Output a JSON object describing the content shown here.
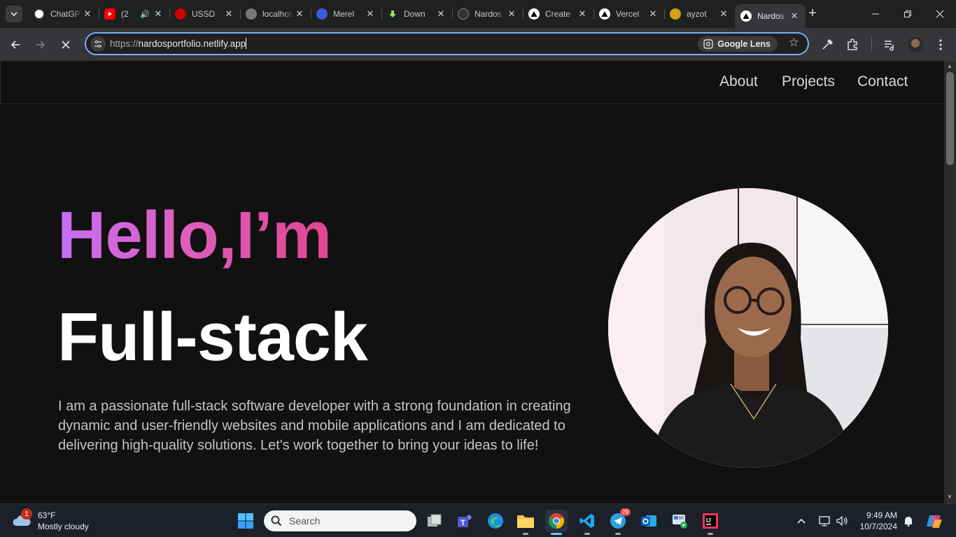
{
  "browser": {
    "tabs": [
      {
        "title": "ChatGPT",
        "favicon": "chatgpt-icon",
        "color": "#ffffff"
      },
      {
        "title": "(2",
        "favicon": "youtube-icon",
        "color": "#ff0000",
        "audio": true
      },
      {
        "title": "USSD",
        "favicon": "redhat-icon",
        "color": "#cc0000"
      },
      {
        "title": "localhost",
        "favicon": "globe-icon",
        "color": "#777777"
      },
      {
        "title": "Merel",
        "favicon": "merel-icon",
        "color": "#3b5bdb"
      },
      {
        "title": "Down",
        "favicon": "download-icon",
        "color": "#4caf50"
      },
      {
        "title": "Nardos",
        "favicon": "github-icon",
        "color": "#333333"
      },
      {
        "title": "Create",
        "favicon": "vercel-icon",
        "color": "#000000"
      },
      {
        "title": "Vercel",
        "favicon": "vercel-icon",
        "color": "#000000"
      },
      {
        "title": "ayzot",
        "favicon": "ayzot-icon",
        "color": "#d4a017"
      },
      {
        "title": "Nardos",
        "favicon": "vercel-icon",
        "color": "#000000",
        "active": true
      }
    ],
    "url_scheme": "https://",
    "url_host": "nardosportfolio.netlify.app",
    "lens_label": "Google Lens"
  },
  "site": {
    "nav": {
      "about": "About",
      "projects": "Projects",
      "contact": "Contact"
    },
    "hello": "Hello,I’m",
    "role": "Full-stack",
    "bio": "I am a passionate full-stack software developer with a strong foundation in creating dynamic and user-friendly websites and mobile applications and I am dedicated to delivering high-quality solutions. Let's work together to bring your ideas to life!"
  },
  "taskbar": {
    "weather_temp": "63°F",
    "weather_desc": "Mostly cloudy",
    "weather_badge": "1",
    "search_placeholder": "Search",
    "telegram_badge": "29",
    "time": "9:49 AM",
    "date": "10/7/2024"
  },
  "colors": {
    "gradient_start": "#c66ef5",
    "gradient_end": "#e0458e",
    "page_bg": "#111111",
    "omnibox_focus": "#7cacf8"
  }
}
